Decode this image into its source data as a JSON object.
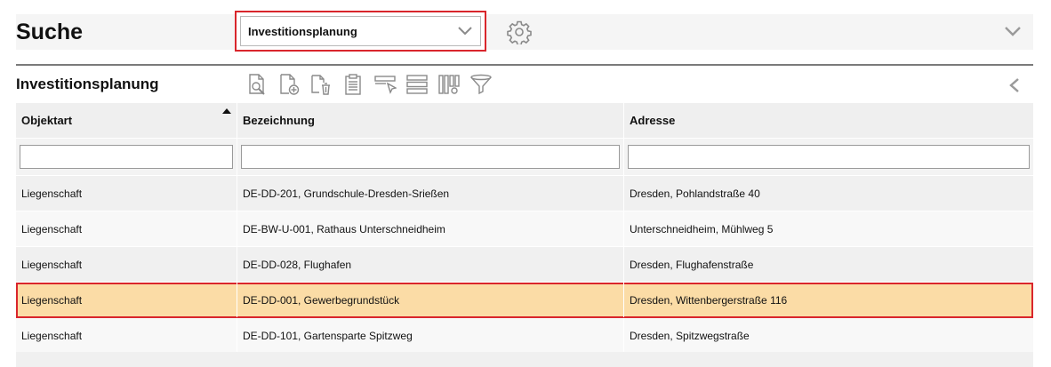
{
  "header": {
    "title": "Suche",
    "selected_view": "Investitionsplanung"
  },
  "section": {
    "title": "Investitionsplanung"
  },
  "toolbar": {
    "icons": [
      "view-details-icon",
      "new-record-icon",
      "delete-record-icon",
      "clipboard-icon",
      "select-rows-icon",
      "row-height-icon",
      "column-settings-icon",
      "filter-icon"
    ]
  },
  "grid": {
    "columns": [
      "Objektart",
      "Bezeichnung",
      "Adresse"
    ],
    "sorted_column": "Objektart",
    "sort_direction": "ascending",
    "filters": [
      "",
      "",
      ""
    ],
    "rows": [
      {
        "objektart": "Liegenschaft",
        "bezeichnung": "DE-DD-201, Grundschule-Dresden-Srießen",
        "adresse": "Dresden, Pohlandstraße 40"
      },
      {
        "objektart": "Liegenschaft",
        "bezeichnung": "DE-BW-U-001, Rathaus Unterschneidheim",
        "adresse": "Unterschneidheim, Mühlweg 5"
      },
      {
        "objektart": "Liegenschaft",
        "bezeichnung": "DE-DD-028, Flughafen",
        "adresse": "Dresden, Flughafenstraße"
      },
      {
        "objektart": "Liegenschaft",
        "bezeichnung": "DE-DD-001, Gewerbegrundstück",
        "adresse": "Dresden, Wittenbergerstraße 116"
      },
      {
        "objektart": "Liegenschaft",
        "bezeichnung": "DE-DD-101, Gartensparte Spitzweg",
        "adresse": "Dresden, Spitzwegstraße"
      }
    ],
    "selected_row_index": 3
  },
  "colors": {
    "highlight_border": "#d9262c",
    "selected_row": "#fbdca6",
    "icon_gray": "#8a8a8a"
  }
}
